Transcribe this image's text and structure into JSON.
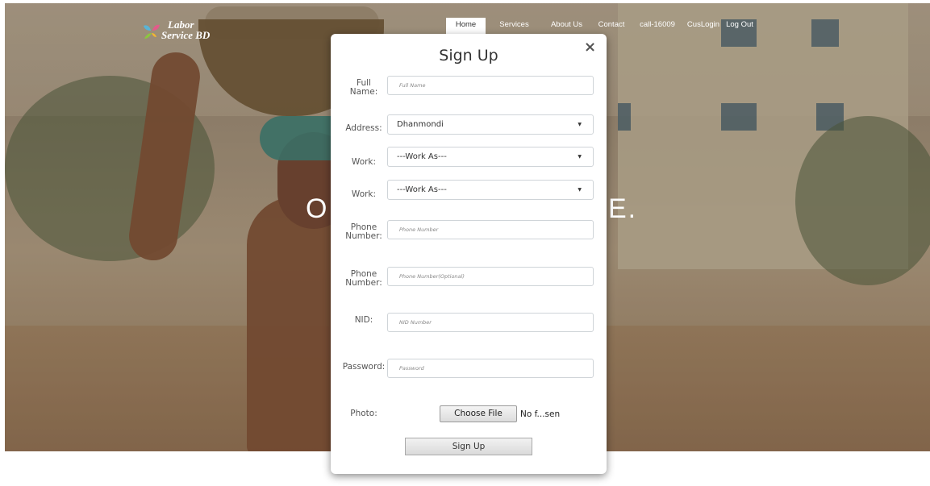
{
  "brand": {
    "line1": "Labor",
    "line2": "Service BD"
  },
  "nav": [
    {
      "label": "Home",
      "active": true
    },
    {
      "label": "Services",
      "active": false
    },
    {
      "label": "About Us",
      "active": false
    },
    {
      "label": "Contact",
      "active": false
    },
    {
      "label": "call-16009",
      "active": false
    },
    {
      "label": "CusLogin",
      "active": false
    },
    {
      "label": "Log Out",
      "active": false
    }
  ],
  "hero": {
    "left_text": "O",
    "right_text": "E."
  },
  "modal": {
    "close_icon": "×",
    "title": "Sign Up",
    "fields": {
      "full_name": {
        "label_l1": "Full",
        "label_l2": "Name:",
        "placeholder": "Full Name"
      },
      "address": {
        "label": "Address:",
        "value": "Dhanmondi"
      },
      "work1": {
        "label": "Work:",
        "value": "---Work As---"
      },
      "work2": {
        "label": "Work:",
        "value": "---Work As---"
      },
      "phone1": {
        "label_l1": "Phone",
        "label_l2": "Number:",
        "placeholder": "Phone Number"
      },
      "phone2": {
        "label_l1": "Phone",
        "label_l2": "Number:",
        "placeholder": "Phone Number(Optional)"
      },
      "nid": {
        "label": "NID:",
        "placeholder": "NID Number"
      },
      "password": {
        "label": "Password:",
        "placeholder": "Password"
      },
      "photo": {
        "label": "Photo:",
        "button": "Choose File",
        "status": "No f...sen"
      }
    },
    "submit_label": "Sign Up"
  },
  "colors": {
    "nav_active_bg": "#ffffff",
    "modal_bg": "#ffffff",
    "input_border": "#cfd4d8"
  }
}
